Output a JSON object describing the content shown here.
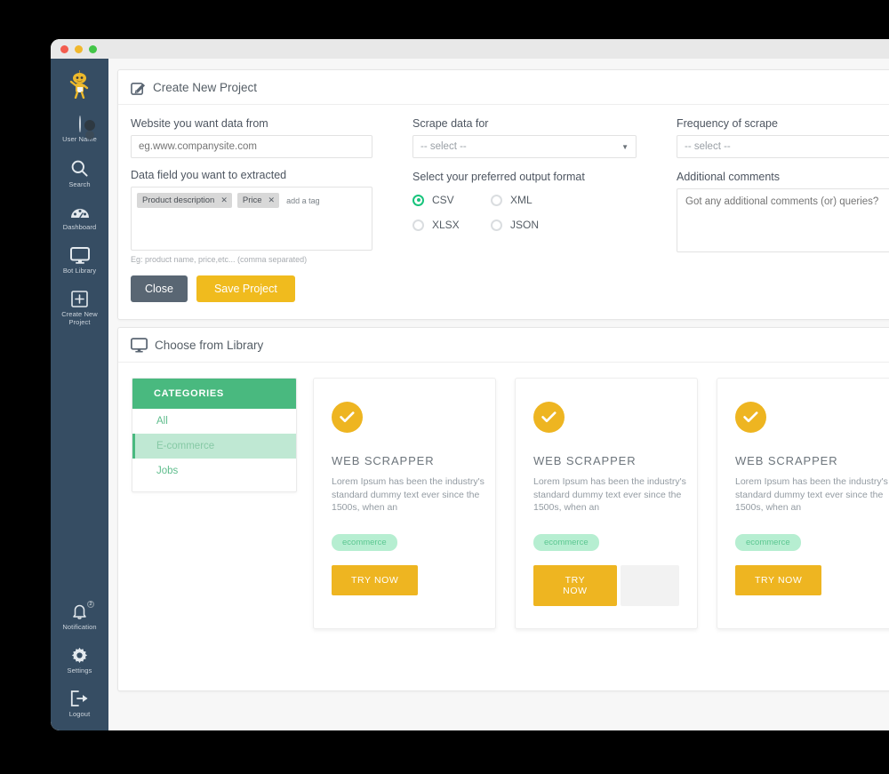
{
  "window": {
    "traffic_lights": [
      "red",
      "yellow",
      "green"
    ]
  },
  "sidebar": {
    "mascot": "robot-mascot",
    "items": [
      {
        "label": "User Name",
        "icon": "user-avatar-icon"
      },
      {
        "label": "Search",
        "icon": "search-icon"
      },
      {
        "label": "Dashboard",
        "icon": "dashboard-icon"
      },
      {
        "label": "Bot Library",
        "icon": "monitor-icon"
      },
      {
        "label": "Create New Project",
        "icon": "plus-square-icon"
      }
    ],
    "bottom_items": [
      {
        "label": "Notification",
        "icon": "bell-icon",
        "badge": "2"
      },
      {
        "label": "Settings",
        "icon": "gear-icon"
      },
      {
        "label": "Logout",
        "icon": "logout-icon"
      }
    ]
  },
  "create_project": {
    "heading": "Create New Project",
    "heading_icon": "edit-pencil-icon",
    "website": {
      "label": "Website you want data from",
      "placeholder": "eg.www.companysite.com",
      "value": ""
    },
    "data_field": {
      "label": "Data field you want to extracted",
      "tags": [
        "Product description",
        "Price"
      ],
      "add_tag_label": "add a tag",
      "hint": "Eg: product name, price,etc...  (comma separated)"
    },
    "scrape_for": {
      "label": "Scrape data for",
      "selected": "-- select --",
      "options": [
        "-- select --"
      ]
    },
    "output_format": {
      "label": "Select your preferred output format",
      "selected": "CSV",
      "options": [
        "CSV",
        "XML",
        "XLSX",
        "JSON"
      ]
    },
    "frequency": {
      "label": "Frequency of scrape",
      "selected": "-- select --",
      "options": [
        "-- select --"
      ]
    },
    "comments": {
      "label": "Additional comments",
      "placeholder": "Got any additional comments (or) queries?",
      "value": ""
    },
    "buttons": {
      "close": "Close",
      "save": "Save Project"
    }
  },
  "library": {
    "heading": "Choose from Library",
    "heading_icon": "monitor-icon",
    "categories": {
      "title": "CATEGORIES",
      "items": [
        {
          "label": "All",
          "active": false
        },
        {
          "label": "E-commerce",
          "active": true
        },
        {
          "label": "Jobs",
          "active": false
        }
      ]
    },
    "cards": [
      {
        "check_icon": "check-circle-icon",
        "title": "WEB SCRAPPER",
        "description": "Lorem Ipsum has been the industry's standard dummy text ever since the 1500s, when an",
        "tag": "ecommerce",
        "button": "TRY NOW",
        "has_ghost_block": false
      },
      {
        "check_icon": "check-circle-icon",
        "title": "WEB SCRAPPER",
        "description": "Lorem Ipsum has been the industry's standard dummy text ever since the 1500s, when an",
        "tag": "ecommerce",
        "button": "TRY NOW",
        "has_ghost_block": true
      },
      {
        "check_icon": "check-circle-icon",
        "title": "WEB SCRAPPER",
        "description": "Lorem Ipsum has been the industry's standard dummy text ever since the 1500s, when an",
        "tag": "ecommerce",
        "button": "TRY NOW",
        "has_ghost_block": false
      }
    ]
  },
  "colors": {
    "sidebar_bg": "#364d63",
    "accent_yellow": "#eeb521",
    "accent_green": "#49b97f",
    "radio_green": "#18c47c",
    "close_gray": "#596673"
  }
}
